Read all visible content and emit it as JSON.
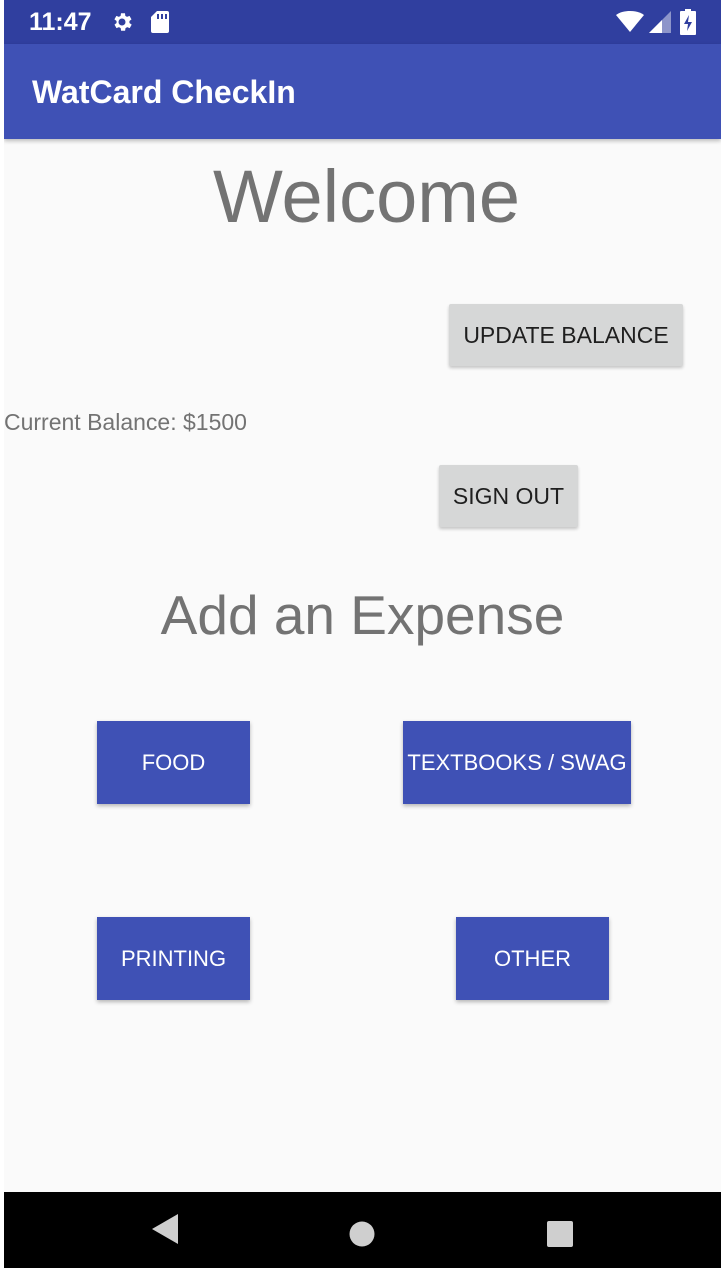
{
  "status_bar": {
    "time": "11:47",
    "icons": [
      "gear-icon",
      "sd-card-icon",
      "wifi-icon",
      "signal-icon",
      "battery-charging-icon"
    ]
  },
  "app_bar": {
    "title": "WatCard CheckIn"
  },
  "main": {
    "welcome_heading": "Welcome",
    "update_balance_label": "UPDATE BALANCE",
    "current_balance_text": "Current Balance: $1500",
    "sign_out_label": "SIGN OUT",
    "add_expense_heading": "Add an Expense",
    "expense_buttons": {
      "food": "FOOD",
      "textbooks_swag": "TEXTBOOKS / SWAG",
      "printing": "PRINTING",
      "other": "OTHER"
    }
  },
  "nav_bar": {
    "icons": [
      "back-icon",
      "home-icon",
      "recents-icon"
    ]
  },
  "colors": {
    "status_bar": "#303f9f",
    "primary": "#3f51b5",
    "grey_button": "#d6d7d7",
    "heading_text": "#737373",
    "background": "#fafafa"
  }
}
